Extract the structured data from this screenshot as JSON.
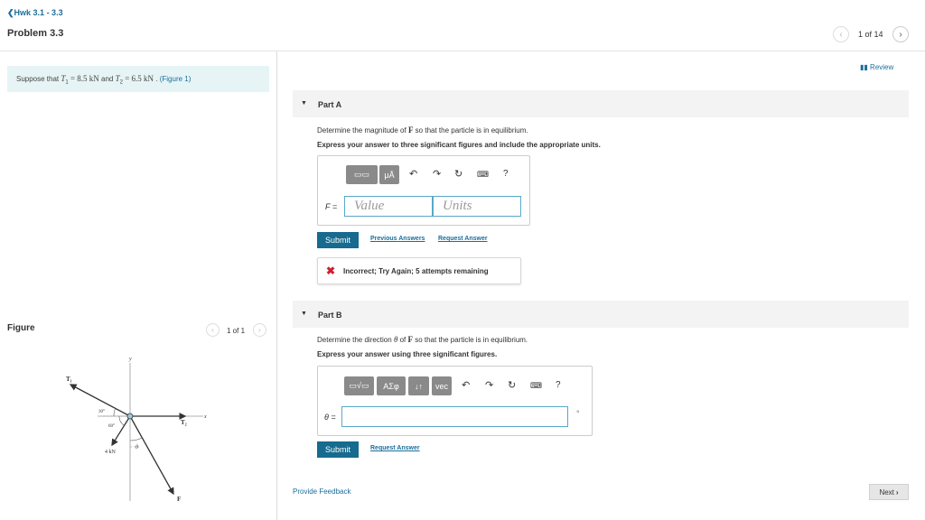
{
  "header": {
    "back_label": "Hwk 3.1 - 3.3",
    "title": "Problem 3.3",
    "count": "1 of 14"
  },
  "statement": {
    "prefix": "Suppose that ",
    "t1": "T",
    "t1_sub": "1",
    "t1_val": " = 8.5  kN",
    "and": " and ",
    "t2": "T",
    "t2_sub": "2",
    "t2_val": " = 6.5  kN",
    "sep": " . ",
    "figure_link": "(Figure 1)"
  },
  "figure": {
    "title": "Figure",
    "count": "1 of 1",
    "labels": {
      "y": "y",
      "x": "x",
      "t1": "T",
      "t1_sub": "1",
      "t2": "T",
      "t2_sub": "2",
      "f": "F",
      "angle30": "30°",
      "angle60": "60°",
      "theta": "θ",
      "force4": "4 kN"
    }
  },
  "review_label": "Review",
  "partA": {
    "title": "Part A",
    "question_pre": "Determine the magnitude of ",
    "question_var": "F",
    "question_post": " so that the particle is in equilibrium.",
    "instruction": "Express your answer to three significant figures and include the appropriate units.",
    "toolbar": {
      "template": "▭▭",
      "units": "μÅ",
      "help": "?"
    },
    "var_label": "F =",
    "value_placeholder": "Value",
    "units_placeholder": "Units",
    "submit": "Submit",
    "previous_answers": "Previous Answers",
    "request_answer": "Request Answer",
    "feedback": "Incorrect; Try Again; 5 attempts remaining"
  },
  "partB": {
    "title": "Part B",
    "question_pre": "Determine the direction ",
    "question_var1": "θ",
    "question_mid": " of ",
    "question_var2": "F",
    "question_post": " so that the particle is in equilibrium.",
    "instruction": "Express your answer using three significant figures.",
    "toolbar": {
      "templates": "▭√▭",
      "greek": "ΑΣφ",
      "arrows": "↓↑",
      "vec": "vec",
      "help": "?"
    },
    "var_label": "θ =",
    "unit": "°",
    "submit": "Submit",
    "request_answer": "Request Answer"
  },
  "footer": {
    "provide_feedback": "Provide Feedback",
    "next": "Next"
  },
  "colors": {
    "accent": "#166b8e",
    "link": "#1a6e9c",
    "statement_bg": "#e6f4f6",
    "error": "#cc1f2d"
  }
}
